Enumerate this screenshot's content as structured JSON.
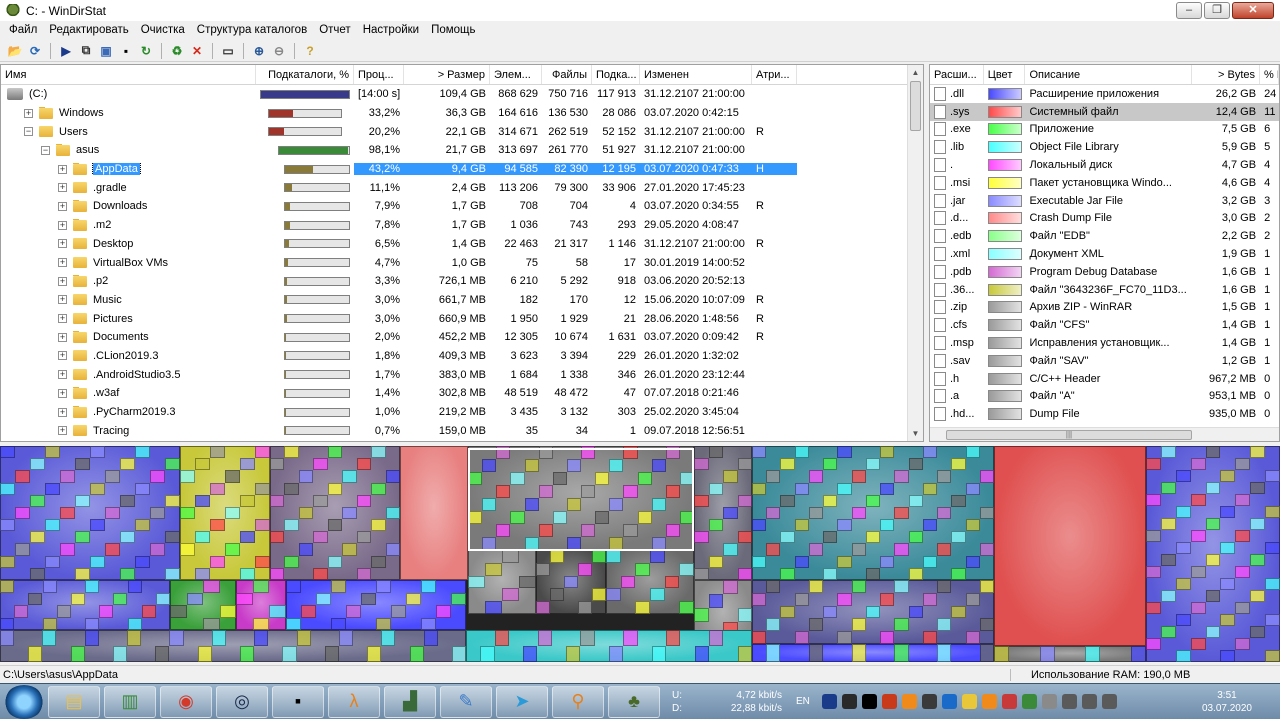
{
  "window": {
    "title": "C: - WinDirStat"
  },
  "menu": [
    "Файл",
    "Редактировать",
    "Очистка",
    "Структура каталогов",
    "Отчет",
    "Настройки",
    "Помощь"
  ],
  "toolbar_icons": [
    "open-icon",
    "refresh-all-icon",
    "sep",
    "play-icon",
    "copy-path-icon",
    "explorer-icon",
    "cmd-prompt-icon",
    "refresh-icon",
    "sep",
    "recycle-icon",
    "delete-icon",
    "sep",
    "properties-icon",
    "sep",
    "zoom-in-icon",
    "zoom-out-icon",
    "sep",
    "help-icon"
  ],
  "tree": {
    "columns": [
      "Имя",
      "Подкаталоги, %",
      "Проц...",
      "> Размер",
      "Элем...",
      "Файлы",
      "Подка...",
      "Изменен",
      "Атри..."
    ],
    "rows": [
      {
        "indent": 0,
        "icon": "drive",
        "exp": "",
        "name": "(C:)",
        "bar": 1.0,
        "barColor": "#3a3a8a",
        "pct": "[14:00 s]",
        "size": "109,4 GB",
        "items": "868 629",
        "files": "750 716",
        "dirs": "117 913",
        "mod": "31.12.2107  21:00:00",
        "attr": ""
      },
      {
        "indent": 1,
        "icon": "folder",
        "exp": "+",
        "name": "Windows",
        "bar": 0.332,
        "barColor": "#a0342b",
        "pct": "33,2%",
        "size": "36,3 GB",
        "items": "164 616",
        "files": "136 530",
        "dirs": "28 086",
        "mod": "03.07.2020  0:42:15",
        "attr": ""
      },
      {
        "indent": 1,
        "icon": "folder",
        "exp": "-",
        "name": "Users",
        "bar": 0.202,
        "barColor": "#a0342b",
        "pct": "20,2%",
        "size": "22,1 GB",
        "items": "314 671",
        "files": "262 519",
        "dirs": "52 152",
        "mod": "31.12.2107  21:00:00",
        "attr": "R"
      },
      {
        "indent": 2,
        "icon": "folder",
        "exp": "-",
        "name": "asus",
        "bar": 0.981,
        "barColor": "#3a8a3a",
        "pct": "98,1%",
        "size": "21,7 GB",
        "items": "313 697",
        "files": "261 770",
        "dirs": "51 927",
        "mod": "31.12.2107  21:00:00",
        "attr": ""
      },
      {
        "indent": 3,
        "icon": "folder",
        "exp": "+",
        "name": "AppData",
        "bar": 0.432,
        "barColor": "#8a7a3a",
        "pct": "43,2%",
        "size": "9,4 GB",
        "items": "94 585",
        "files": "82 390",
        "dirs": "12 195",
        "mod": "03.07.2020  0:47:33",
        "attr": "H",
        "selected": true
      },
      {
        "indent": 3,
        "icon": "folder",
        "exp": "+",
        "name": ".gradle",
        "bar": 0.111,
        "barColor": "#8a7a3a",
        "pct": "11,1%",
        "size": "2,4 GB",
        "items": "113 206",
        "files": "79 300",
        "dirs": "33 906",
        "mod": "27.01.2020  17:45:23",
        "attr": ""
      },
      {
        "indent": 3,
        "icon": "folder",
        "exp": "+",
        "name": "Downloads",
        "bar": 0.079,
        "barColor": "#8a7a3a",
        "pct": "7,9%",
        "size": "1,7 GB",
        "items": "708",
        "files": "704",
        "dirs": "4",
        "mod": "03.07.2020  0:34:55",
        "attr": "R"
      },
      {
        "indent": 3,
        "icon": "folder",
        "exp": "+",
        "name": ".m2",
        "bar": 0.078,
        "barColor": "#8a7a3a",
        "pct": "7,8%",
        "size": "1,7 GB",
        "items": "1 036",
        "files": "743",
        "dirs": "293",
        "mod": "29.05.2020  4:08:47",
        "attr": ""
      },
      {
        "indent": 3,
        "icon": "folder",
        "exp": "+",
        "name": "Desktop",
        "bar": 0.065,
        "barColor": "#8a7a3a",
        "pct": "6,5%",
        "size": "1,4 GB",
        "items": "22 463",
        "files": "21 317",
        "dirs": "1 146",
        "mod": "31.12.2107  21:00:00",
        "attr": "R"
      },
      {
        "indent": 3,
        "icon": "folder",
        "exp": "+",
        "name": "VirtualBox VMs",
        "bar": 0.047,
        "barColor": "#8a7a3a",
        "pct": "4,7%",
        "size": "1,0 GB",
        "items": "75",
        "files": "58",
        "dirs": "17",
        "mod": "30.01.2019  14:00:52",
        "attr": ""
      },
      {
        "indent": 3,
        "icon": "folder",
        "exp": "+",
        "name": ".p2",
        "bar": 0.033,
        "barColor": "#8a7a3a",
        "pct": "3,3%",
        "size": "726,1 MB",
        "items": "6 210",
        "files": "5 292",
        "dirs": "918",
        "mod": "03.06.2020  20:52:13",
        "attr": ""
      },
      {
        "indent": 3,
        "icon": "folder",
        "exp": "+",
        "name": "Music",
        "bar": 0.03,
        "barColor": "#8a7a3a",
        "pct": "3,0%",
        "size": "661,7 MB",
        "items": "182",
        "files": "170",
        "dirs": "12",
        "mod": "15.06.2020  10:07:09",
        "attr": "R"
      },
      {
        "indent": 3,
        "icon": "folder",
        "exp": "+",
        "name": "Pictures",
        "bar": 0.03,
        "barColor": "#8a7a3a",
        "pct": "3,0%",
        "size": "660,9 MB",
        "items": "1 950",
        "files": "1 929",
        "dirs": "21",
        "mod": "28.06.2020  1:48:56",
        "attr": "R"
      },
      {
        "indent": 3,
        "icon": "folder",
        "exp": "+",
        "name": "Documents",
        "bar": 0.02,
        "barColor": "#8a7a3a",
        "pct": "2,0%",
        "size": "452,2 MB",
        "items": "12 305",
        "files": "10 674",
        "dirs": "1 631",
        "mod": "03.07.2020  0:09:42",
        "attr": "R"
      },
      {
        "indent": 3,
        "icon": "folder",
        "exp": "+",
        "name": ".CLion2019.3",
        "bar": 0.018,
        "barColor": "#8a7a3a",
        "pct": "1,8%",
        "size": "409,3 MB",
        "items": "3 623",
        "files": "3 394",
        "dirs": "229",
        "mod": "26.01.2020  1:32:02",
        "attr": ""
      },
      {
        "indent": 3,
        "icon": "folder",
        "exp": "+",
        "name": ".AndroidStudio3.5",
        "bar": 0.017,
        "barColor": "#8a7a3a",
        "pct": "1,7%",
        "size": "383,0 MB",
        "items": "1 684",
        "files": "1 338",
        "dirs": "346",
        "mod": "26.01.2020  23:12:44",
        "attr": ""
      },
      {
        "indent": 3,
        "icon": "folder",
        "exp": "+",
        "name": ".w3af",
        "bar": 0.014,
        "barColor": "#8a7a3a",
        "pct": "1,4%",
        "size": "302,8 MB",
        "items": "48 519",
        "files": "48 472",
        "dirs": "47",
        "mod": "07.07.2018  0:21:46",
        "attr": ""
      },
      {
        "indent": 3,
        "icon": "folder",
        "exp": "+",
        "name": ".PyCharm2019.3",
        "bar": 0.01,
        "barColor": "#8a7a3a",
        "pct": "1,0%",
        "size": "219,2 MB",
        "items": "3 435",
        "files": "3 132",
        "dirs": "303",
        "mod": "25.02.2020  3:45:04",
        "attr": ""
      },
      {
        "indent": 3,
        "icon": "folder",
        "exp": "+",
        "name": "Tracing",
        "bar": 0.007,
        "barColor": "#8a7a3a",
        "pct": "0,7%",
        "size": "159,0 MB",
        "items": "35",
        "files": "34",
        "dirs": "1",
        "mod": "09.07.2018  12:56:51",
        "attr": ""
      }
    ]
  },
  "ext": {
    "columns": [
      "Расши...",
      "Цвет",
      "Описание",
      "> Bytes",
      "% E"
    ],
    "rows": [
      {
        "ext": ".dll",
        "color": "#4a4aff",
        "desc": "Расширение приложения",
        "bytes": "26,2 GB",
        "pct": "24"
      },
      {
        "ext": ".sys",
        "color": "#ff4a4a",
        "desc": "Системный файл",
        "bytes": "12,4 GB",
        "pct": "11",
        "selected": true
      },
      {
        "ext": ".exe",
        "color": "#4aff4a",
        "desc": "Приложение",
        "bytes": "7,5 GB",
        "pct": "6"
      },
      {
        "ext": ".lib",
        "color": "#4affff",
        "desc": "Object File Library",
        "bytes": "5,9 GB",
        "pct": "5"
      },
      {
        "ext": ".",
        "color": "#ff4aff",
        "desc": "Локальный диск",
        "bytes": "4,7 GB",
        "pct": "4"
      },
      {
        "ext": ".msi",
        "color": "#ffff3a",
        "desc": "Пакет установщика Windo...",
        "bytes": "4,6 GB",
        "pct": "4"
      },
      {
        "ext": ".jar",
        "color": "#8a8aff",
        "desc": "Executable Jar File",
        "bytes": "3,2 GB",
        "pct": "3"
      },
      {
        "ext": ".d...",
        "color": "#ff8a8a",
        "desc": "Crash Dump File",
        "bytes": "3,0 GB",
        "pct": "2"
      },
      {
        "ext": ".edb",
        "color": "#8aff8a",
        "desc": "Файл \"EDB\"",
        "bytes": "2,2 GB",
        "pct": "2"
      },
      {
        "ext": ".xml",
        "color": "#8affff",
        "desc": "Документ XML",
        "bytes": "1,9 GB",
        "pct": "1"
      },
      {
        "ext": ".pdb",
        "color": "#d46ad4",
        "desc": "Program Debug Database",
        "bytes": "1,6 GB",
        "pct": "1"
      },
      {
        "ext": ".36...",
        "color": "#c8c83a",
        "desc": "Файл \"3643236F_FC70_11D3...",
        "bytes": "1,6 GB",
        "pct": "1"
      },
      {
        "ext": ".zip",
        "color": "#9a9a9a",
        "desc": "Архив ZIP - WinRAR",
        "bytes": "1,5 GB",
        "pct": "1"
      },
      {
        "ext": ".cfs",
        "color": "#9a9a9a",
        "desc": "Файл \"CFS\"",
        "bytes": "1,4 GB",
        "pct": "1"
      },
      {
        "ext": ".msp",
        "color": "#9a9a9a",
        "desc": "Исправления установщик...",
        "bytes": "1,4 GB",
        "pct": "1"
      },
      {
        "ext": ".sav",
        "color": "#9a9a9a",
        "desc": "Файл \"SAV\"",
        "bytes": "1,2 GB",
        "pct": "1"
      },
      {
        "ext": ".h",
        "color": "#9a9a9a",
        "desc": "C/C++ Header",
        "bytes": "967,2 MB",
        "pct": "0"
      },
      {
        "ext": ".a",
        "color": "#9a9a9a",
        "desc": "Файл \"A\"",
        "bytes": "953,1 MB",
        "pct": "0"
      },
      {
        "ext": ".hd...",
        "color": "#9a9a9a",
        "desc": "Dump File",
        "bytes": "935,0 MB",
        "pct": "0"
      }
    ]
  },
  "status": {
    "path": "C:\\Users\\asus\\AppData",
    "ram": "Использование RAM:   190,0 MB"
  },
  "taskbar": {
    "apps": [
      "explorer-icon",
      "monitor-icon",
      "chrome-icon",
      "steam-icon",
      "terminal-icon",
      "half-life-icon",
      "chart-icon",
      "paint-icon",
      "telegram-icon",
      "search-app-icon",
      "windirstat-icon"
    ],
    "net_up_label": "U:",
    "net_up": "4,72 kbit/s",
    "net_down_label": "D:",
    "net_down": "22,88 kbit/s",
    "lang": "EN",
    "time": "3:51",
    "date": "03.07.2020"
  }
}
